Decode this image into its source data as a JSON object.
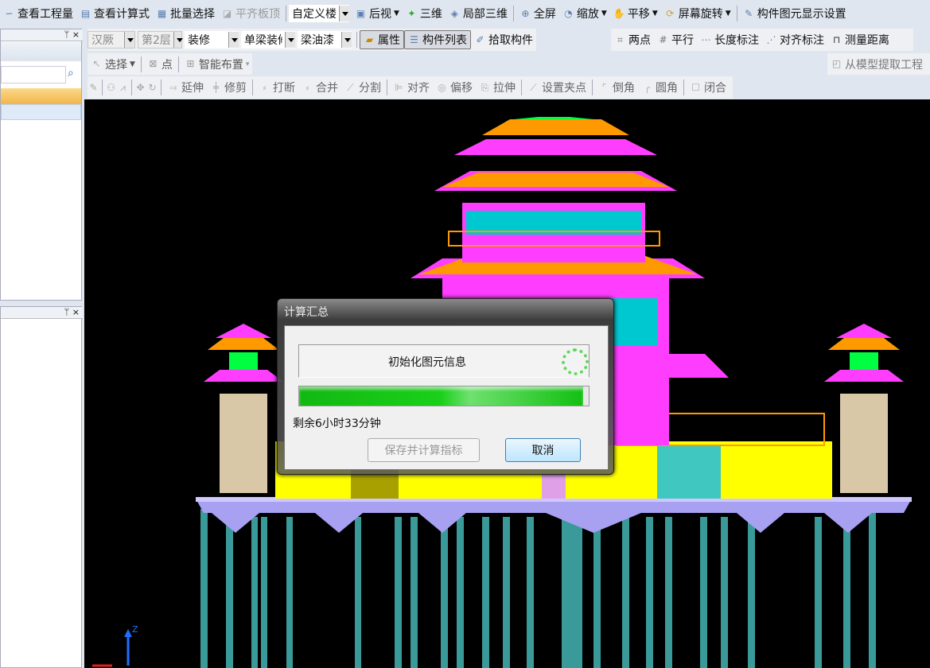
{
  "toolbar1": {
    "items": [
      {
        "label": "查看工程量",
        "icon": "view-quantity-icon"
      },
      {
        "label": "查看计算式",
        "icon": "view-formula-icon"
      },
      {
        "label": "批量选择",
        "icon": "batch-select-icon"
      },
      {
        "label": "平齐板顶",
        "icon": "align-slab-top-icon",
        "disabled": true
      }
    ],
    "view_select": "自定义楼",
    "view_items": [
      {
        "label": "后视",
        "icon": "back-view-icon",
        "dropdown": true
      },
      {
        "label": "三维",
        "icon": "3d-icon"
      },
      {
        "label": "局部三维",
        "icon": "local-3d-icon"
      },
      {
        "label": "全屏",
        "icon": "fullscreen-icon"
      },
      {
        "label": "缩放",
        "icon": "zoom-icon",
        "dropdown": true
      },
      {
        "label": "平移",
        "icon": "pan-icon",
        "dropdown": true
      },
      {
        "label": "屏幕旋转",
        "icon": "rotate-screen-icon",
        "dropdown": true
      },
      {
        "label": "构件图元显示设置",
        "icon": "display-settings-icon"
      }
    ]
  },
  "toolbar2": {
    "selects": [
      "汉厥",
      "第2层",
      "装修",
      "单梁装修",
      "梁油漆"
    ],
    "properties": "属性",
    "component_list": "构件列表",
    "pick": "拾取构件",
    "measure": [
      "两点",
      "平行",
      "长度标注",
      "对齐标注",
      "测量距离"
    ]
  },
  "toolbar3": {
    "select": "选择",
    "point": "点",
    "smart": "智能布置",
    "extract": "从模型提取工程"
  },
  "toolbar4": [
    "延伸",
    "修剪",
    "打断",
    "合并",
    "分割",
    "对齐",
    "偏移",
    "拉伸",
    "设置夹点",
    "倒角",
    "圆角",
    "闭合"
  ],
  "panel": {
    "pin": "ᛘ",
    "close": "×"
  },
  "dialog": {
    "title": "计算汇总",
    "status": "初始化图元信息",
    "progress": 0.98,
    "remaining": "剩余6小时33分钟",
    "save_button": "保存并计算指标",
    "cancel_button": "取消"
  },
  "axis": {
    "z": "Z"
  }
}
